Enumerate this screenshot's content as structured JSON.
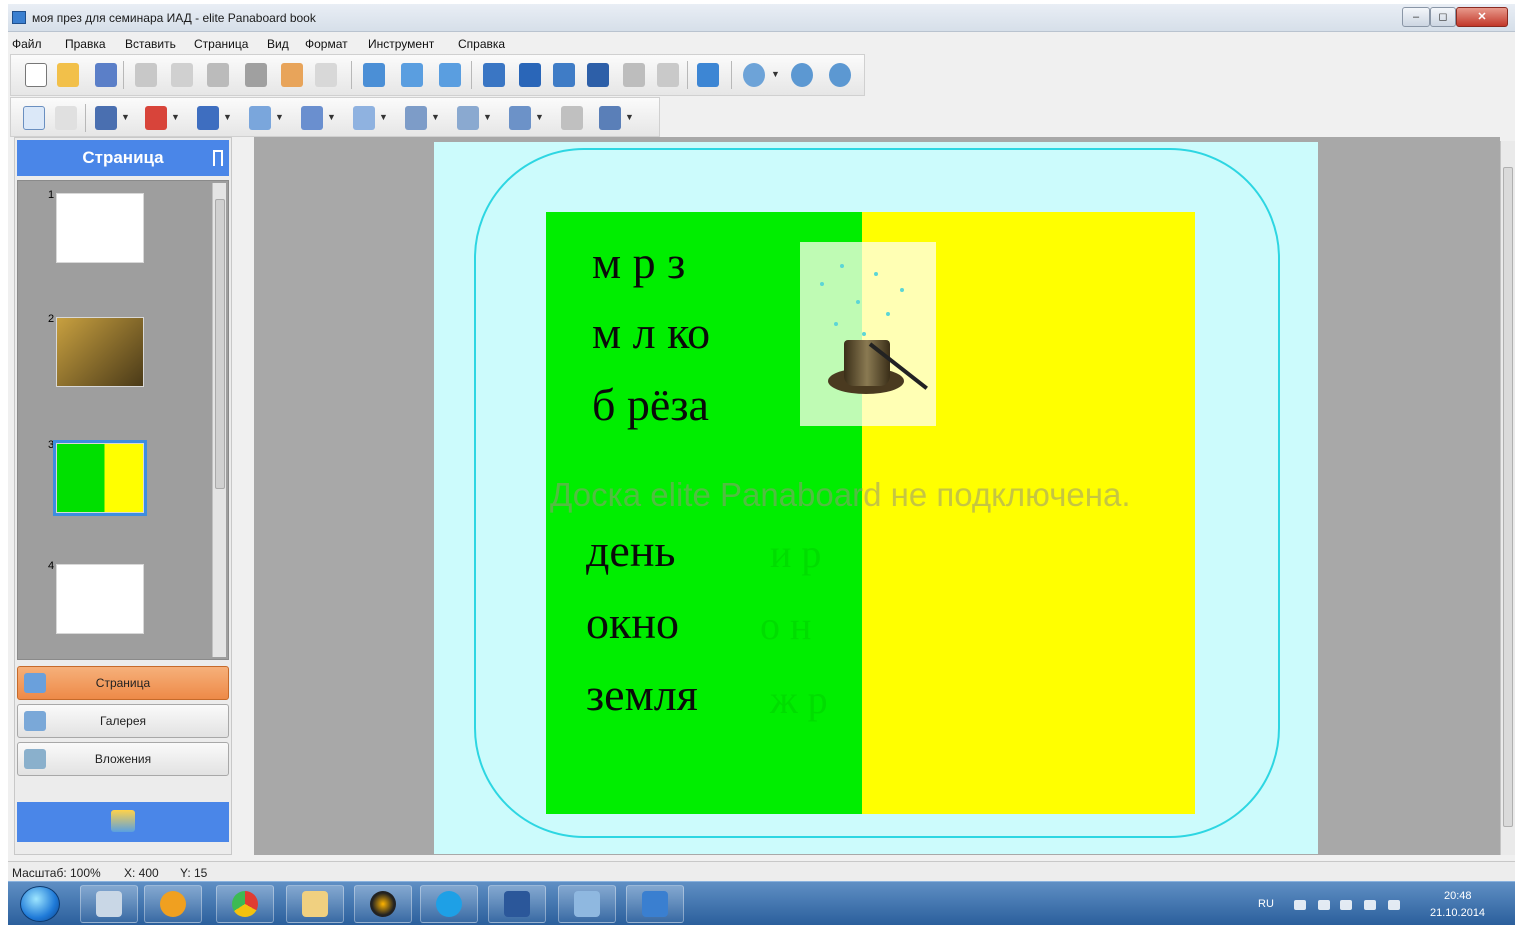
{
  "window": {
    "title": "моя през для семинара ИАД - elite Panaboard book",
    "controls": {
      "minimize": "–",
      "maximize": "◻",
      "close": "✕"
    }
  },
  "menu": [
    "Файл",
    "Правка",
    "Вставить",
    "Страница",
    "Вид",
    "Формат",
    "Инструмент",
    "Справка"
  ],
  "toolbar_icons": [
    "new-page-icon",
    "open-icon",
    "save-icon",
    "cut-icon",
    "copy-icon",
    "delete-icon",
    "paste-icon",
    "undo-icon",
    "redo-icon",
    "insert-page-icon",
    "prev-page-icon",
    "next-page-icon",
    "camera-icon",
    "screen-capture-icon",
    "image-icon",
    "record-icon",
    "print-icon",
    "pdf-icon",
    "email-icon",
    "zoom-icon",
    "zoom-in-icon",
    "zoom-out-icon"
  ],
  "pen_tools": [
    "select-icon",
    "object-select-icon",
    "pen-icon",
    "red-pen-icon",
    "blue-pen-icon",
    "marker-icon",
    "stamp-icon",
    "shape-icon",
    "eraser-icon",
    "line-icon",
    "fill-icon",
    "connector-icon",
    "text-icon"
  ],
  "left_panel": {
    "header": "Страница",
    "thumbnails": [
      {
        "number": "1",
        "selected": false
      },
      {
        "number": "2",
        "selected": false
      },
      {
        "number": "3",
        "selected": true
      },
      {
        "number": "4",
        "selected": false
      }
    ],
    "buttons": [
      {
        "label": "Страница",
        "active": true
      },
      {
        "label": "Галерея",
        "active": false
      },
      {
        "label": "Вложения",
        "active": false
      }
    ]
  },
  "slide": {
    "left_words": [
      "м  р  з",
      "м  л  ко",
      "б  рёза",
      "день",
      "окно",
      "земля"
    ],
    "hidden_letters": [
      "и  р",
      "о  н",
      "ж  р"
    ],
    "watermark": "Доска elite Panaboard не подключена.",
    "colors": {
      "green": "#00ee00",
      "yellow": "#ffff00",
      "background": "#ccfbfc",
      "frame": "#2dd6e2"
    }
  },
  "status": {
    "zoom": "Масштаб: 100%",
    "x": "X: 400",
    "y": "Y: 15"
  },
  "taskbar": {
    "apps": [
      "calculator-icon",
      "media-player-icon",
      "chrome-icon",
      "file-explorer-icon",
      "app-icon",
      "skype-icon",
      "word-icon",
      "files-icon",
      "panaboard-icon"
    ],
    "language": "RU",
    "time": "20:48",
    "date": "21.10.2014"
  }
}
